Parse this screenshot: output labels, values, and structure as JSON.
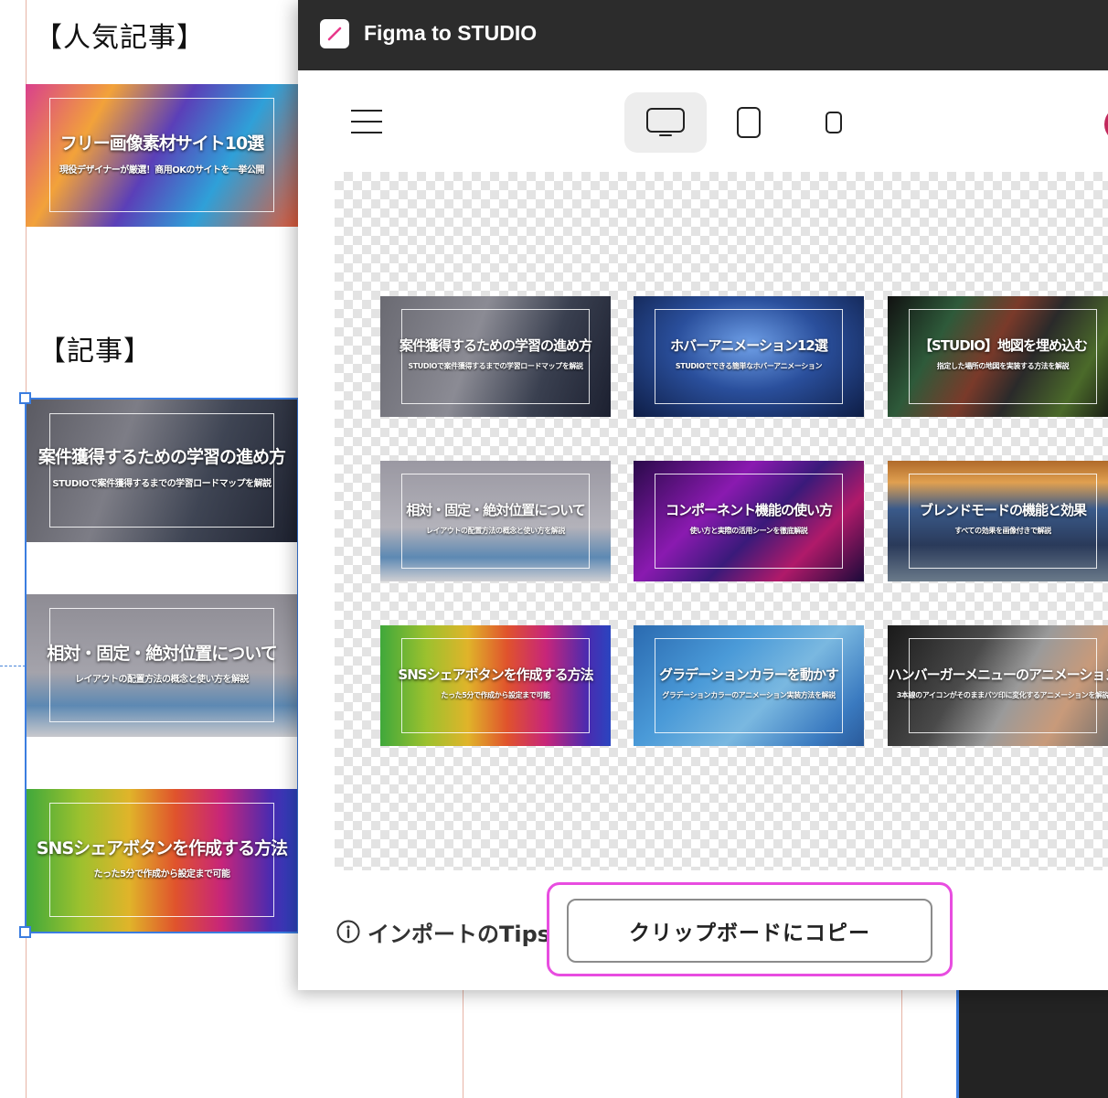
{
  "canvas": {
    "popular_heading": "【人気記事】",
    "articles_heading": "【記事】",
    "cards": [
      {
        "title": "フリー画像素材サイト10選",
        "subtitle": "現役デザイナーが厳選！商用OKのサイトを一挙公開"
      },
      {
        "title": "案件獲得するための学習の進め方",
        "subtitle": "STUDIOで案件獲得するまでの学習ロードマップを解説"
      },
      {
        "title": "相対・固定・絶対位置について",
        "subtitle": "レイアウトの配置方法の概念と使い方を解説"
      },
      {
        "title": "SNSシェアボタンを作成する方法",
        "subtitle": "たった5分で作成から設定まで可能"
      }
    ]
  },
  "plugin": {
    "app_icon": "figma-to-studio-logo-icon",
    "title": "Figma to STUDIO",
    "toolbar": {
      "menu_icon": "hamburger-menu-icon",
      "devices": [
        {
          "name": "desktop",
          "icon": "desktop-icon",
          "active": true
        },
        {
          "name": "tablet",
          "icon": "tablet-icon",
          "active": false
        },
        {
          "name": "mobile",
          "icon": "mobile-icon",
          "active": false
        }
      ]
    },
    "preview_cards": [
      {
        "title": "案件獲得するための学習の進め方",
        "subtitle": "STUDIOで案件獲得するまでの学習ロードマップを解説"
      },
      {
        "title": "ホバーアニメーション12選",
        "subtitle": "STUDIOでできる簡単なホバーアニメーション"
      },
      {
        "title": "【STUDIO】地図を埋め込む",
        "subtitle": "指定した場所の地図を実装する方法を解説"
      },
      {
        "title": "相対・固定・絶対位置について",
        "subtitle": "レイアウトの配置方法の概念と使い方を解説"
      },
      {
        "title": "コンポーネント機能の使い方",
        "subtitle": "使い方と実際の活用シーンを徹底解説"
      },
      {
        "title": "ブレンドモードの機能と効果",
        "subtitle": "すべての効果を画像付きで解説"
      },
      {
        "title": "SNSシェアボタンを作成する方法",
        "subtitle": "たった5分で作成から設定まで可能"
      },
      {
        "title": "グラデーションカラーを動かす",
        "subtitle": "グラデーションカラーのアニメーション実装方法を解説"
      },
      {
        "title": "ハンバーガーメニューのアニメーション",
        "subtitle": "3本線のアイコンがそのままバツ印に変化するアニメーションを解説"
      }
    ],
    "footer": {
      "tips_icon": "info-icon",
      "tips_label": "インポートのTips",
      "copy_button": "クリップボードにコピー"
    }
  },
  "colors": {
    "titlebar": "#2c2c2c",
    "highlight": "#e84de0",
    "selection": "#3b7de0"
  }
}
